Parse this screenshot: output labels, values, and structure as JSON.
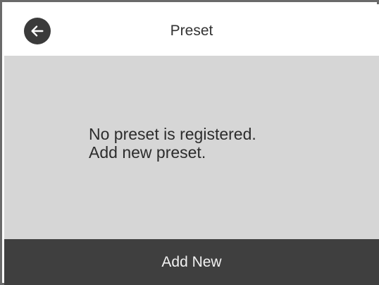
{
  "header": {
    "title": "Preset",
    "back_icon": "arrow-left-icon"
  },
  "content": {
    "line1": "No preset is registered.",
    "line2": "Add new preset."
  },
  "footer": {
    "button_label": "Add New"
  },
  "colors": {
    "header_bg": "#ffffff",
    "content_bg": "#d6d6d6",
    "footer_bg": "#3f3f3f",
    "back_button_bg": "#3b3b3b",
    "border": "#6a6a6a"
  }
}
